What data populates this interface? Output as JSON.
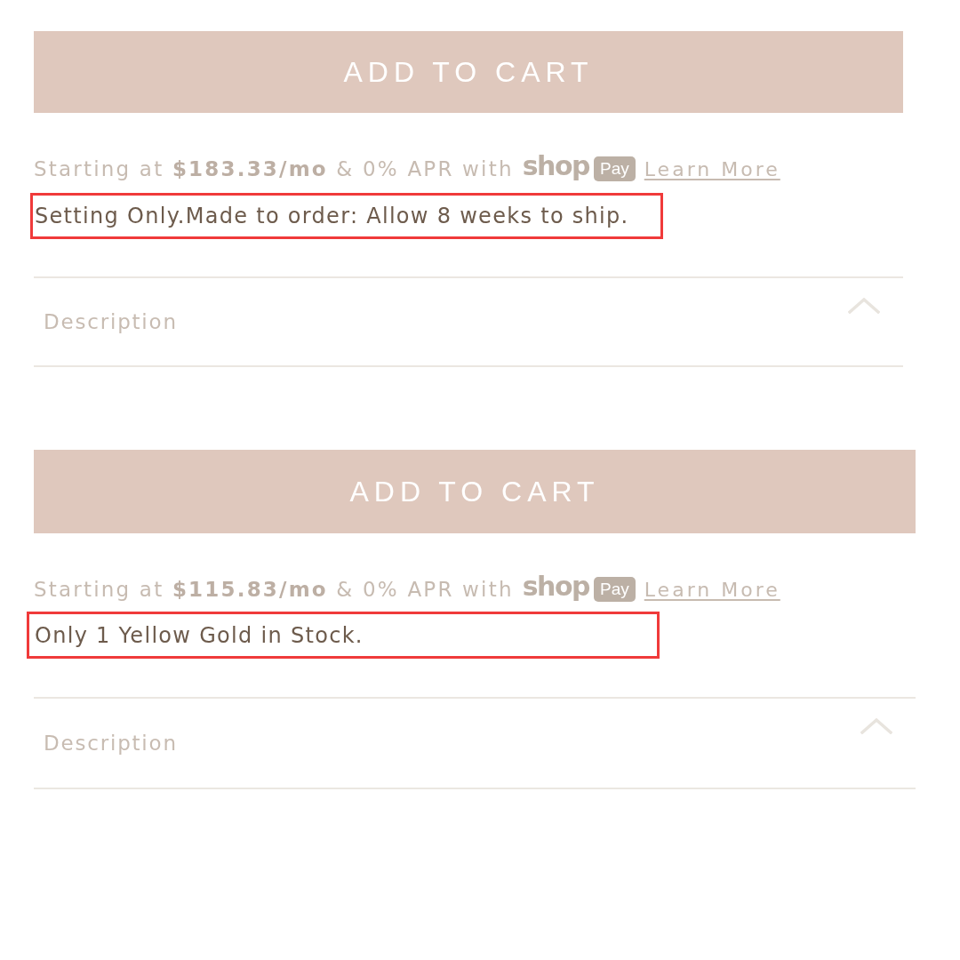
{
  "products": [
    {
      "button": "ADD TO CART",
      "financing": {
        "text": "Starting at **$183.33/mo** & 0% APR with",
        "logo": {
          "wordmark": "shop",
          "badge": "Pay"
        },
        "link": "Learn More"
      },
      "notice": {
        "text": "Setting Only.Made to order: Allow 8 weeks to ship.",
        "highlighted": true
      },
      "accordion": {
        "label": "Description"
      }
    },
    {
      "button": "ADD TO CART",
      "financing": {
        "text": "Starting at **$115.83/mo** & 0% APR with",
        "logo": {
          "wordmark": "shop",
          "badge": "Pay"
        },
        "link": "Learn More"
      },
      "notice": {
        "text": "Only 1 Yellow Gold in Stock.",
        "highlighted": true
      },
      "accordion": {
        "label": "Description"
      }
    }
  ]
}
